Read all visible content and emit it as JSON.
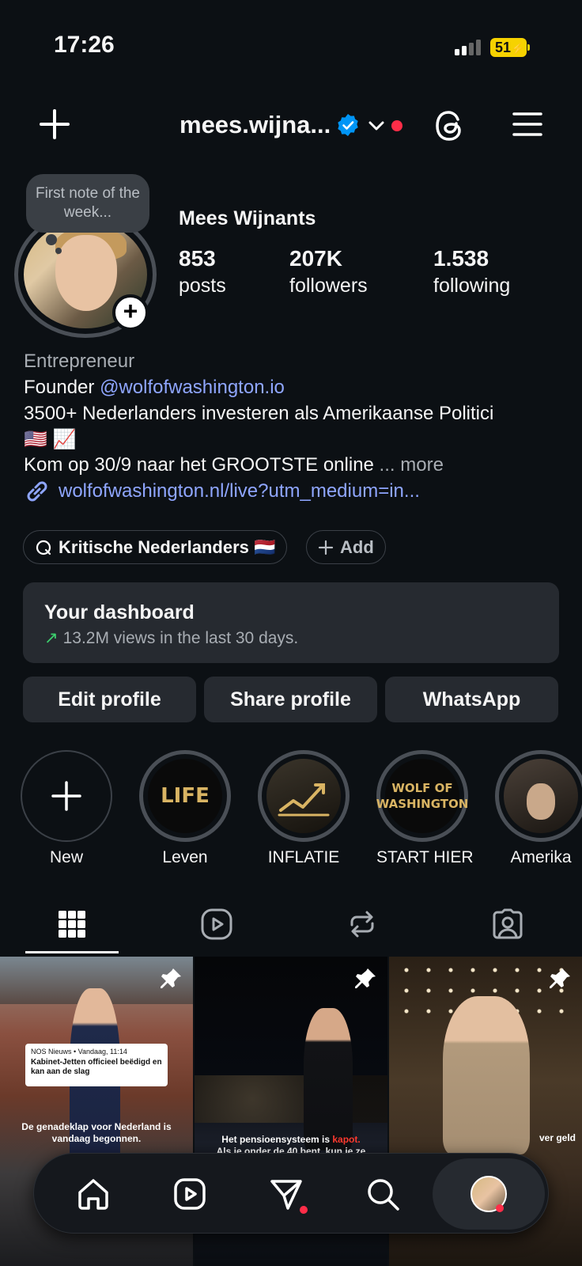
{
  "status": {
    "time": "17:26",
    "battery": "51"
  },
  "header": {
    "username": "mees.wijna..."
  },
  "profile": {
    "note": "First note of the week...",
    "full_name": "Mees Wijnants",
    "posts_count": "853",
    "posts_label": "posts",
    "followers_count": "207K",
    "followers_label": "followers",
    "following_count": "1.538",
    "following_label": "following"
  },
  "bio": {
    "category": "Entrepreneur",
    "line1_prefix": "Founder ",
    "line1_mention": "@wolfofwashington.io",
    "line2": "3500+ Nederlanders investeren als Amerikaanse Politici",
    "line3": "🇺🇸 📈",
    "line4": "Kom op 30/9 naar het GROOTSTE online",
    "more_ellipsis": " ... ",
    "more": "more",
    "link": "wolfofwashington.nl/live?utm_medium=in..."
  },
  "pills": {
    "community": "Kritische Nederlanders 🇳🇱",
    "add": "Add"
  },
  "dashboard": {
    "title": "Your dashboard",
    "arrow": "↗",
    "subtitle": "13.2M views in the last 30 days."
  },
  "buttons": {
    "edit": "Edit profile",
    "share": "Share profile",
    "whatsapp": "WhatsApp"
  },
  "highlights": [
    {
      "label": "New"
    },
    {
      "label": "Leven",
      "cover": "LIFE"
    },
    {
      "label": "INFLATIE"
    },
    {
      "label": "START HIER",
      "cover": "WOLF OF WASHINGTON"
    },
    {
      "label": "Amerika"
    }
  ],
  "posts": [
    {
      "news_source": "NOS Nieuws • Vandaag, 11:14",
      "news_title": "Kabinet-Jetten officieel beëdigd en kan aan de slag",
      "caption": "De genadeklap voor Nederland is vandaag begonnen."
    },
    {
      "caption_prefix": "Het pensioensysteem is ",
      "caption_highlight": "kapot.",
      "caption_cut": "Als je onder de 40 bent, kun je ze"
    },
    {
      "caption": "ver geld"
    }
  ],
  "colors": {
    "accent_link": "#8fa6ff",
    "notification": "#ff2d48",
    "verified": "#0095f6",
    "trend": "#3ccf6d"
  }
}
